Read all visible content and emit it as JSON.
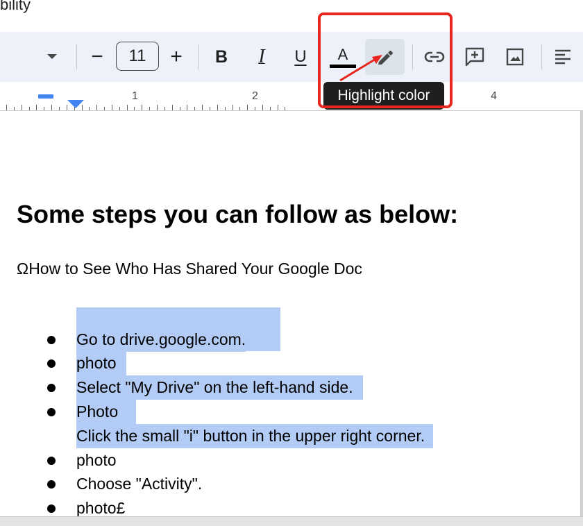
{
  "menu": {
    "fragment_text": "bility"
  },
  "toolbar": {
    "font_size_value": "11",
    "decrease_label": "−",
    "increase_label": "+",
    "bold_label": "B",
    "italic_label": "I",
    "underline_label": "U",
    "text_color_label": "A",
    "icons": [
      "chevron-down-icon",
      "pencil-highlighter-icon",
      "link-icon",
      "add-comment-icon",
      "image-icon",
      "align-left-icon"
    ]
  },
  "tooltip": {
    "text": "Highlight color"
  },
  "ruler": {
    "numbers": [
      "1",
      "2",
      "4"
    ]
  },
  "document": {
    "heading": "Some steps you can follow as below:",
    "subtitle": "ΩHow to See Who Has Shared Your Google Doc",
    "items": [
      {
        "text": "Go to drive.google.com.",
        "bullet": true,
        "selected": true
      },
      {
        "text": "photo",
        "bullet": true,
        "selected": true
      },
      {
        "text": "Select \"My Drive\" on the left-hand side.",
        "bullet": true,
        "selected": true
      },
      {
        "text": "Photo",
        "bullet": true,
        "selected": true
      },
      {
        "text": "Click the small \"i\" button in the upper right corner.",
        "bullet": false,
        "selected": true
      },
      {
        "text": "photo",
        "bullet": true,
        "selected": false
      },
      {
        "text": "Choose \"Activity\".",
        "bullet": true,
        "selected": false
      },
      {
        "text": "photo£",
        "bullet": true,
        "selected": false
      }
    ]
  },
  "colors": {
    "toolbar_bg": "#edf2fa",
    "selection": "#b3ccf5",
    "annotation_red": "#e8261f",
    "ruler_indent": "#4285f4",
    "tooltip_bg": "#1f1f1f"
  }
}
